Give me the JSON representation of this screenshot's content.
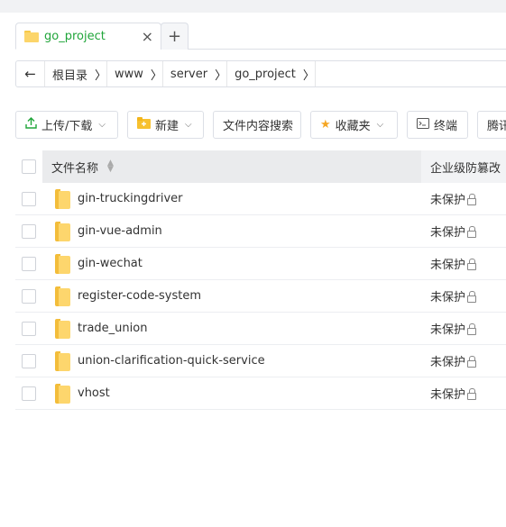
{
  "tabs": [
    {
      "label": "go_project",
      "close": "×",
      "icon": "folder-icon"
    }
  ],
  "tab_add": "+",
  "breadcrumb": {
    "back": "←",
    "items": [
      "根目录",
      "www",
      "server",
      "go_project"
    ],
    "separator": "〉"
  },
  "toolbar": {
    "upload": {
      "label": "上传/下载",
      "icon": "upload-icon"
    },
    "new": {
      "label": "新建",
      "icon": "new-folder-icon"
    },
    "search": {
      "label": "文件内容搜索"
    },
    "favorites": {
      "label": "收藏夹",
      "icon": "star-icon"
    },
    "terminal": {
      "label": "终端",
      "icon": "terminal-icon"
    },
    "tencent": {
      "label": "腾讯"
    }
  },
  "table": {
    "headers": {
      "name": "文件名称",
      "protect": "企业级防篡改"
    },
    "rows": [
      {
        "name": "gin-truckingdriver",
        "status": "未保护"
      },
      {
        "name": "gin-vue-admin",
        "status": "未保护"
      },
      {
        "name": "gin-wechat",
        "status": "未保护"
      },
      {
        "name": "register-code-system",
        "status": "未保护"
      },
      {
        "name": "trade_union",
        "status": "未保护"
      },
      {
        "name": "union-clarification-quick-service",
        "status": "未保护"
      },
      {
        "name": "vhost",
        "status": "未保护"
      }
    ]
  },
  "colors": {
    "accent": "#20a53a",
    "folder": "#fcd56a",
    "header_bg": "#eaebed"
  }
}
